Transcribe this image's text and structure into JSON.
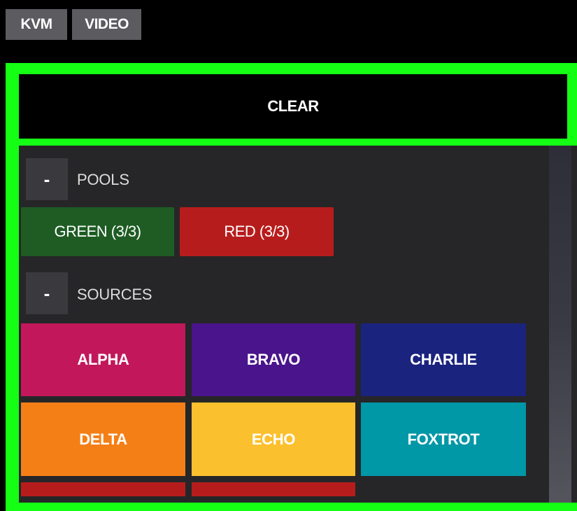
{
  "tabs": [
    {
      "label": "KVM"
    },
    {
      "label": "VIDEO"
    }
  ],
  "accent_color": "#14ff14",
  "clear_button": {
    "label": "CLEAR"
  },
  "pools_section": {
    "toggle": "-",
    "label": "POOLS",
    "items": [
      {
        "label": "GREEN (3/3)",
        "color": "#1e5c23"
      },
      {
        "label": "RED (3/3)",
        "color": "#b71c1c"
      }
    ]
  },
  "sources_section": {
    "toggle": "-",
    "label": "SOURCES",
    "items": [
      {
        "label": "ALPHA",
        "color": "#c2185b"
      },
      {
        "label": "BRAVO",
        "color": "#4a148c"
      },
      {
        "label": "CHARLIE",
        "color": "#1a237e"
      },
      {
        "label": "DELTA",
        "color": "#f57f17"
      },
      {
        "label": "ECHO",
        "color": "#fbc02d"
      },
      {
        "label": "FOXTROT",
        "color": "#0097a7"
      },
      {
        "label": "",
        "color": "#b71c1c"
      },
      {
        "label": "",
        "color": "#b71c1c"
      }
    ]
  }
}
